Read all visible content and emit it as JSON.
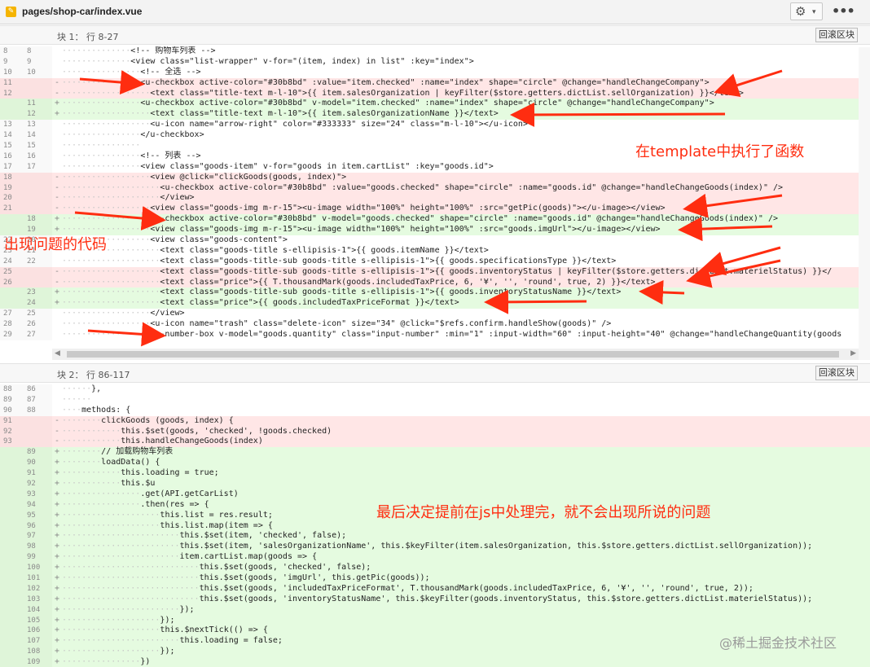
{
  "file": {
    "path": "pages/shop-car/index.vue",
    "icon": "vue-file-icon"
  },
  "toolbar": {
    "gear_icon": "gear-icon",
    "more": "•••"
  },
  "block1": {
    "label": "块 1： 行 8-27",
    "button": "回滚区块",
    "rows": [
      {
        "t": "c",
        "o": "8",
        "n": "8",
        "i": 14,
        "s": "<!-- 购物车列表 -->"
      },
      {
        "t": "c",
        "o": "9",
        "n": "9",
        "i": 14,
        "s": "<view class=\"list-wrapper\" v-for=\"(item, index) in list\" :key=\"index\">"
      },
      {
        "t": "c",
        "o": "10",
        "n": "10",
        "i": 16,
        "s": "<!-- 全选 -->"
      },
      {
        "t": "d",
        "o": "11",
        "n": "",
        "i": 16,
        "s": "<u-checkbox active-color=\"#30b8bd\" :value=\"item.checked\" :name=\"index\" shape=\"circle\" @change=\"handleChangeCompany\">"
      },
      {
        "t": "d",
        "o": "12",
        "n": "",
        "i": 18,
        "s": "<text class=\"title-text m-l-10\">{{ item.salesOrganization | keyFilter($store.getters.dictList.sellOrganization) }}</text>"
      },
      {
        "t": "a",
        "o": "",
        "n": "11",
        "i": 16,
        "s": "<u-checkbox active-color=\"#30b8bd\" v-model=\"item.checked\" :name=\"index\" shape=\"circle\" @change=\"handleChangeCompany\">"
      },
      {
        "t": "a",
        "o": "",
        "n": "12",
        "i": 18,
        "s": "<text class=\"title-text m-l-10\">{{ item.salesOrganizationName }}</text>"
      },
      {
        "t": "c",
        "o": "13",
        "n": "13",
        "i": 18,
        "s": "<u-icon name=\"arrow-right\" color=\"#333333\" size=\"24\" class=\"m-l-10\"></u-icon>"
      },
      {
        "t": "c",
        "o": "14",
        "n": "14",
        "i": 16,
        "s": "</u-checkbox>"
      },
      {
        "t": "c",
        "o": "15",
        "n": "15",
        "i": 16,
        "s": ""
      },
      {
        "t": "c",
        "o": "16",
        "n": "16",
        "i": 16,
        "s": "<!-- 列表 -->"
      },
      {
        "t": "c",
        "o": "17",
        "n": "17",
        "i": 16,
        "s": "<view class=\"goods-item\" v-for=\"goods in item.cartList\" :key=\"goods.id\">"
      },
      {
        "t": "d",
        "o": "18",
        "n": "",
        "i": 18,
        "s": "<view @click=\"clickGoods(goods, index)\">"
      },
      {
        "t": "d",
        "o": "19",
        "n": "",
        "i": 20,
        "s": "<u-checkbox active-color=\"#30b8bd\" :value=\"goods.checked\" shape=\"circle\" :name=\"goods.id\" @change=\"handleChangeGoods(index)\" />"
      },
      {
        "t": "d",
        "o": "20",
        "n": "",
        "i": 20,
        "s": "</view>"
      },
      {
        "t": "d",
        "o": "21",
        "n": "",
        "i": 18,
        "s": "<view class=\"goods-img m-r-15\"><u-image width=\"100%\" height=\"100%\" :src=\"getPic(goods)\"></u-image></view>"
      },
      {
        "t": "a",
        "o": "",
        "n": "18",
        "i": 18,
        "s": "<u-checkbox active-color=\"#30b8bd\" v-model=\"goods.checked\" shape=\"circle\" :name=\"goods.id\" @change=\"handleChangeGoods(index)\" />"
      },
      {
        "t": "a",
        "o": "",
        "n": "19",
        "i": 18,
        "s": "<view class=\"goods-img m-r-15\"><u-image width=\"100%\" height=\"100%\" :src=\"goods.imgUrl\"></u-image></view>"
      },
      {
        "t": "c",
        "o": "22",
        "n": "20",
        "i": 18,
        "s": "<view class=\"goods-content\">"
      },
      {
        "t": "c",
        "o": "23",
        "n": "21",
        "i": 20,
        "s": "<text class=\"goods-title s-ellipisis-1\">{{ goods.itemName }}</text>"
      },
      {
        "t": "c",
        "o": "24",
        "n": "22",
        "i": 20,
        "s": "<text class=\"goods-title-sub goods-title s-ellipisis-1\">{{ goods.specificationsType }}</text>"
      },
      {
        "t": "d",
        "o": "25",
        "n": "",
        "i": 20,
        "s": "<text class=\"goods-title-sub goods-title s-ellipisis-1\">{{ goods.inventoryStatus | keyFilter($store.getters.dictList.materielStatus) }}</"
      },
      {
        "t": "d",
        "o": "26",
        "n": "",
        "i": 20,
        "s": "<text class=\"price\">{{ T.thousandMark(goods.includedTaxPrice, 6, '¥', '', 'round', true, 2) }}</text>"
      },
      {
        "t": "a",
        "o": "",
        "n": "23",
        "i": 20,
        "s": "<text class=\"goods-title-sub goods-title s-ellipisis-1\">{{ goods.inventoryStatusName }}</text>"
      },
      {
        "t": "a",
        "o": "",
        "n": "24",
        "i": 20,
        "s": "<text class=\"price\">{{ goods.includedTaxPriceFormat }}</text>"
      },
      {
        "t": "c",
        "o": "27",
        "n": "25",
        "i": 18,
        "s": "</view>"
      },
      {
        "t": "c",
        "o": "28",
        "n": "26",
        "i": 18,
        "s": "<u-icon name=\"trash\" class=\"delete-icon\" size=\"34\" @click=\"$refs.confirm.handleShow(goods)\" />"
      },
      {
        "t": "c",
        "o": "29",
        "n": "27",
        "i": 18,
        "s": "<u-number-box v-model=\"goods.quantity\" class=\"input-number\" :min=\"1\" :input-width=\"60\" :input-height=\"40\" @change=\"handleChangeQuantity(goods"
      }
    ]
  },
  "block2": {
    "label": "块 2： 行 86-117",
    "button": "回滚区块",
    "rows": [
      {
        "t": "c",
        "o": "88",
        "n": "86",
        "i": 6,
        "s": "},"
      },
      {
        "t": "c",
        "o": "89",
        "n": "87",
        "i": 6,
        "s": ""
      },
      {
        "t": "c",
        "o": "90",
        "n": "88",
        "i": 4,
        "s": "methods: {"
      },
      {
        "t": "d",
        "o": "91",
        "n": "",
        "i": 8,
        "s": "clickGoods (goods, index) {"
      },
      {
        "t": "d",
        "o": "92",
        "n": "",
        "i": 12,
        "s": "this.$set(goods, 'checked', !goods.checked)"
      },
      {
        "t": "d",
        "o": "93",
        "n": "",
        "i": 12,
        "s": "this.handleChangeGoods(index)"
      },
      {
        "t": "a",
        "o": "",
        "n": "89",
        "i": 8,
        "s": "// 加载购物车列表"
      },
      {
        "t": "a",
        "o": "",
        "n": "90",
        "i": 8,
        "s": "loadData() {"
      },
      {
        "t": "a",
        "o": "",
        "n": "91",
        "i": 12,
        "s": "this.loading = true;"
      },
      {
        "t": "a",
        "o": "",
        "n": "92",
        "i": 12,
        "s": "this.$u"
      },
      {
        "t": "a",
        "o": "",
        "n": "93",
        "i": 16,
        "s": ".get(API.getCarList)"
      },
      {
        "t": "a",
        "o": "",
        "n": "94",
        "i": 16,
        "s": ".then(res => {"
      },
      {
        "t": "a",
        "o": "",
        "n": "95",
        "i": 20,
        "s": "this.list = res.result;"
      },
      {
        "t": "a",
        "o": "",
        "n": "96",
        "i": 20,
        "s": "this.list.map(item => {"
      },
      {
        "t": "a",
        "o": "",
        "n": "97",
        "i": 24,
        "s": "this.$set(item, 'checked', false);"
      },
      {
        "t": "a",
        "o": "",
        "n": "98",
        "i": 24,
        "s": "this.$set(item, 'salesOrganizationName', this.$keyFilter(item.salesOrganization, this.$store.getters.dictList.sellOrganization));"
      },
      {
        "t": "a",
        "o": "",
        "n": "99",
        "i": 24,
        "s": "item.cartList.map(goods => {"
      },
      {
        "t": "a",
        "o": "",
        "n": "100",
        "i": 28,
        "s": "this.$set(goods, 'checked', false);"
      },
      {
        "t": "a",
        "o": "",
        "n": "101",
        "i": 28,
        "s": "this.$set(goods, 'imgUrl', this.getPic(goods));"
      },
      {
        "t": "a",
        "o": "",
        "n": "102",
        "i": 28,
        "s": "this.$set(goods, 'includedTaxPriceFormat', T.thousandMark(goods.includedTaxPrice, 6, '¥', '', 'round', true, 2));"
      },
      {
        "t": "a",
        "o": "",
        "n": "103",
        "i": 28,
        "s": "this.$set(goods, 'inventoryStatusName', this.$keyFilter(goods.inventoryStatus, this.$store.getters.dictList.materielStatus));"
      },
      {
        "t": "a",
        "o": "",
        "n": "104",
        "i": 24,
        "s": "});"
      },
      {
        "t": "a",
        "o": "",
        "n": "105",
        "i": 20,
        "s": "});"
      },
      {
        "t": "a",
        "o": "",
        "n": "106",
        "i": 20,
        "s": "this.$nextTick(() => {"
      },
      {
        "t": "a",
        "o": "",
        "n": "107",
        "i": 24,
        "s": "this.loading = false;"
      },
      {
        "t": "a",
        "o": "",
        "n": "108",
        "i": 20,
        "s": "});"
      },
      {
        "t": "a",
        "o": "",
        "n": "109",
        "i": 16,
        "s": "})"
      }
    ]
  },
  "annotations": {
    "template_note": "在template中执行了函数",
    "problem_note": "出现问题的代码",
    "solution_note": "最后决定提前在js中处理完，就不会出现所说的问题"
  },
  "watermark": "@稀土掘金技术社区",
  "colors": {
    "deleted_bg": "#ffe6e6",
    "added_bg": "#e5fbe0",
    "annotation": "#ff2d10"
  }
}
